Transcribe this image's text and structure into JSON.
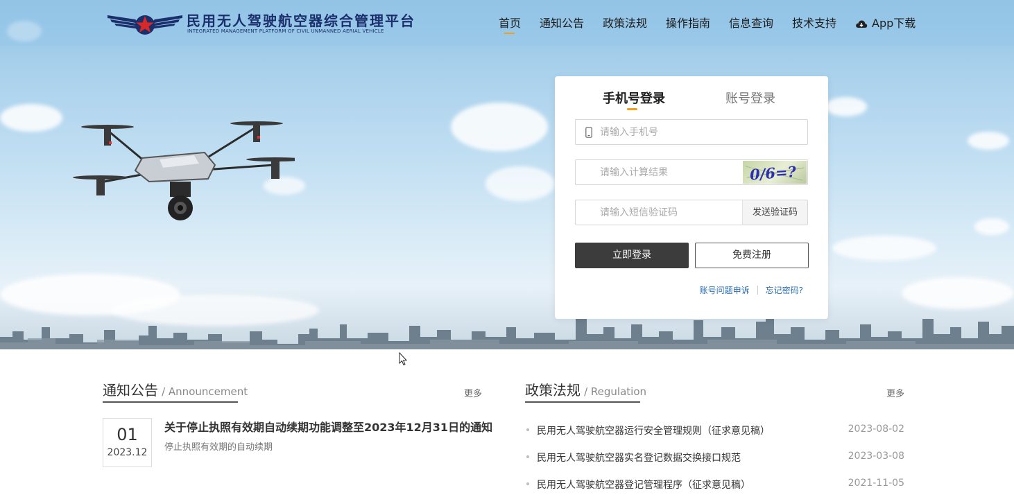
{
  "header": {
    "logo_title": "民用无人驾驶航空器综合管理平台",
    "logo_subtitle": "INTEGRATED MANAGEMENT PLATFORM OF CIVIL UNMANNED AERIAL VEHICLE",
    "nav": [
      {
        "label": "首页",
        "active": true
      },
      {
        "label": "通知公告"
      },
      {
        "label": "政策法规"
      },
      {
        "label": "操作指南"
      },
      {
        "label": "信息查询"
      },
      {
        "label": "技术支持"
      },
      {
        "label": "App下载",
        "icon": "cloud-download-icon"
      }
    ]
  },
  "login": {
    "tab_phone": "手机号登录",
    "tab_account": "账号登录",
    "phone_placeholder": "请输入手机号",
    "calc_placeholder": "请输入计算结果",
    "sms_placeholder": "请输入短信验证码",
    "captcha_text": "0/6=?",
    "send_code": "发送验证码",
    "login_button": "立即登录",
    "register_button": "免费注册",
    "appeal_link": "账号问题申诉",
    "forgot_link": "忘记密码?"
  },
  "announcement": {
    "title_cn": "通知公告",
    "title_en": "/ Announcement",
    "more": "更多",
    "items": [
      {
        "day": "01",
        "year_month": "2023.12",
        "title": "关于停止执照有效期自动续期功能调整至2023年12月31日的通知",
        "desc": "停止执照有效期的自动续期"
      }
    ]
  },
  "regulation": {
    "title_cn": "政策法规",
    "title_en": "/ Regulation",
    "more": "更多",
    "items": [
      {
        "title": "民用无人驾驶航空器运行安全管理规则（征求意见稿）",
        "date": "2023-08-02"
      },
      {
        "title": "民用无人驾驶航空器实名登记数据交换接口规范",
        "date": "2023-03-08"
      },
      {
        "title": "民用无人驾驶航空器登记管理程序（征求意见稿）",
        "date": "2021-11-05"
      }
    ]
  },
  "colors": {
    "brand_navy": "#1a2f6b",
    "accent": "#f0a020",
    "link": "#2a6fb5",
    "button_dark": "#3c3c3c"
  }
}
